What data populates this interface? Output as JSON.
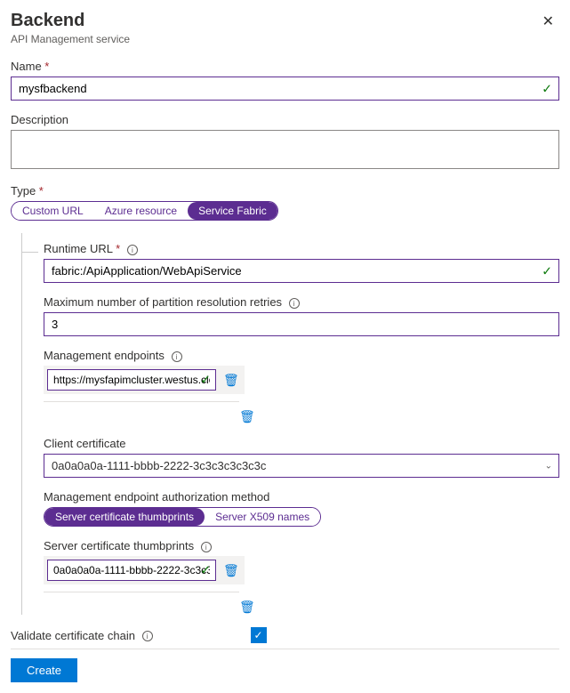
{
  "header": {
    "title": "Backend",
    "subtitle": "API Management service"
  },
  "name": {
    "label": "Name",
    "value": "mysfbackend"
  },
  "description": {
    "label": "Description",
    "value": ""
  },
  "type": {
    "label": "Type",
    "options": {
      "custom": "Custom URL",
      "azure": "Azure resource",
      "sf": "Service Fabric"
    }
  },
  "runtime": {
    "label": "Runtime URL",
    "value": "fabric:/ApiApplication/WebApiService"
  },
  "retries": {
    "label": "Maximum number of partition resolution retries",
    "value": "3"
  },
  "endpoints": {
    "label": "Management endpoints",
    "value": "https://mysfapimcluster.westus.cloud..."
  },
  "clientcert": {
    "label": "Client certificate",
    "value": "0a0a0a0a-1111-bbbb-2222-3c3c3c3c3c3c"
  },
  "authmethod": {
    "label": "Management endpoint authorization method",
    "options": {
      "thumb": "Server certificate thumbprints",
      "x509": "Server X509 names"
    }
  },
  "thumbprints": {
    "label": "Server certificate thumbprints",
    "value": "0a0a0a0a-1111-bbbb-2222-3c3c3c..."
  },
  "validate": {
    "label": "Validate certificate chain"
  },
  "footer": {
    "create": "Create"
  }
}
